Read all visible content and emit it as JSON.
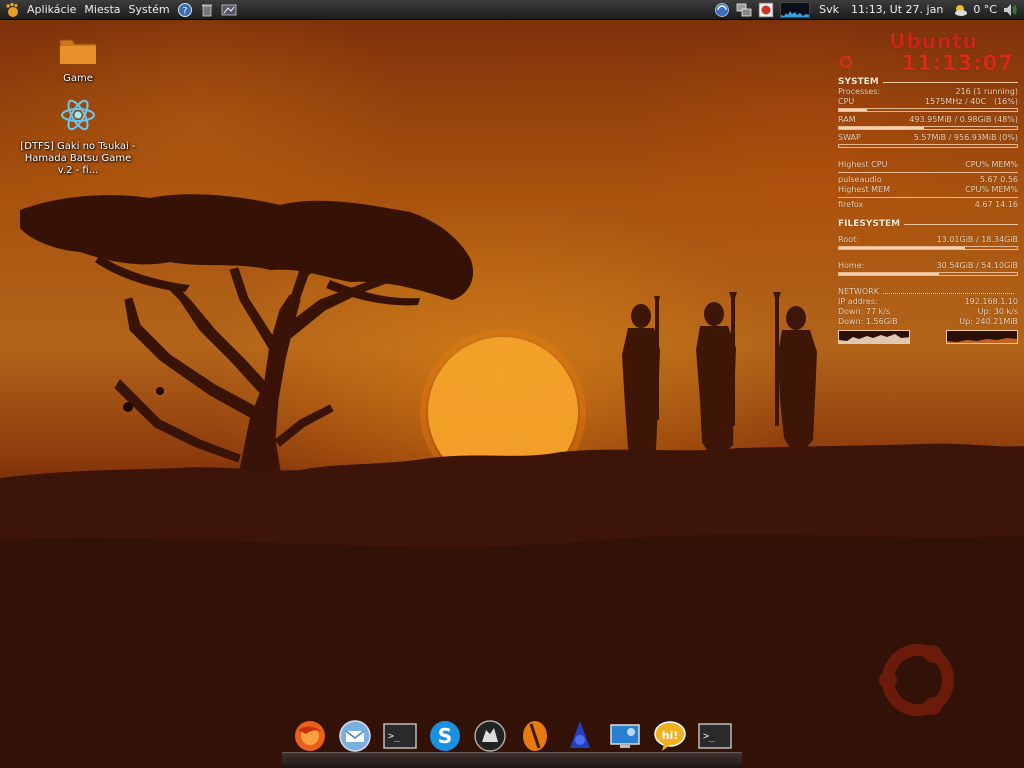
{
  "top_panel": {
    "menus": [
      "Aplikácie",
      "Miesta",
      "Systém"
    ],
    "keyboard_layout": "Svk",
    "datetime": "11:13, Ut 27. jan",
    "weather": "0 °C"
  },
  "desktop": {
    "icons": [
      {
        "label": "Game",
        "icon": "folder-icon"
      },
      {
        "label": "[DTFS] Gaki no Tsukai - Hamada Batsu Game v.2 - fi...",
        "icon": "atom-icon"
      }
    ]
  },
  "conky": {
    "brand": "Ubuntu",
    "time": "11:13:07",
    "system_title": "SYSTEM",
    "processes_label": "Processes:",
    "processes_value": "216 (1 running)",
    "cpu_label": "CPU",
    "cpu_freq": "1575MHz / 40C",
    "cpu_pct": "(16%)",
    "cpu_fraction": 0.16,
    "ram_label": "RAM",
    "ram_value": "493.95MiB / 0.98GiB (48%)",
    "ram_fraction": 0.48,
    "swap_label": "SWAP",
    "swap_value": "5.57MiB / 956.93MiB (0%)",
    "swap_fraction": 0.0,
    "highest_cpu_label": "Highest CPU",
    "highest_cpu_cols": "CPU% MEM%",
    "highest_cpu_proc": "pulseaudio",
    "highest_cpu_vals": "5.67  0.56",
    "highest_mem_label": "Highest MEM",
    "highest_mem_cols": "CPU% MEM%",
    "highest_mem_proc": "firefox",
    "highest_mem_vals": "4.67 14.16",
    "fs_title": "FILESYSTEM",
    "root_label": "Root:",
    "root_value": "13.01GiB / 18.34GiB",
    "root_fraction": 0.71,
    "home_label": "Home:",
    "home_value": "30.54GiB / 54.10GiB",
    "home_fraction": 0.56,
    "net_title": "NETWORK",
    "ip_label": "IP addres:",
    "ip_value": "192.168.1.10",
    "down_label": "Down: 77 k/s",
    "up_label": "Up: 30 k/s",
    "down_total": "Down: 1.56GiB",
    "up_total": "Up: 240.21MiB"
  },
  "dock": {
    "items": [
      "firefox-icon",
      "mail-icon",
      "terminal-icon",
      "skype-icon",
      "wolf-icon",
      "orange-icon",
      "wizard-icon",
      "monitor-icon",
      "chat-icon",
      "terminal-icon"
    ]
  },
  "colors": {
    "brand_red": "#c8261a",
    "conky_text": "#f2d5b8"
  }
}
